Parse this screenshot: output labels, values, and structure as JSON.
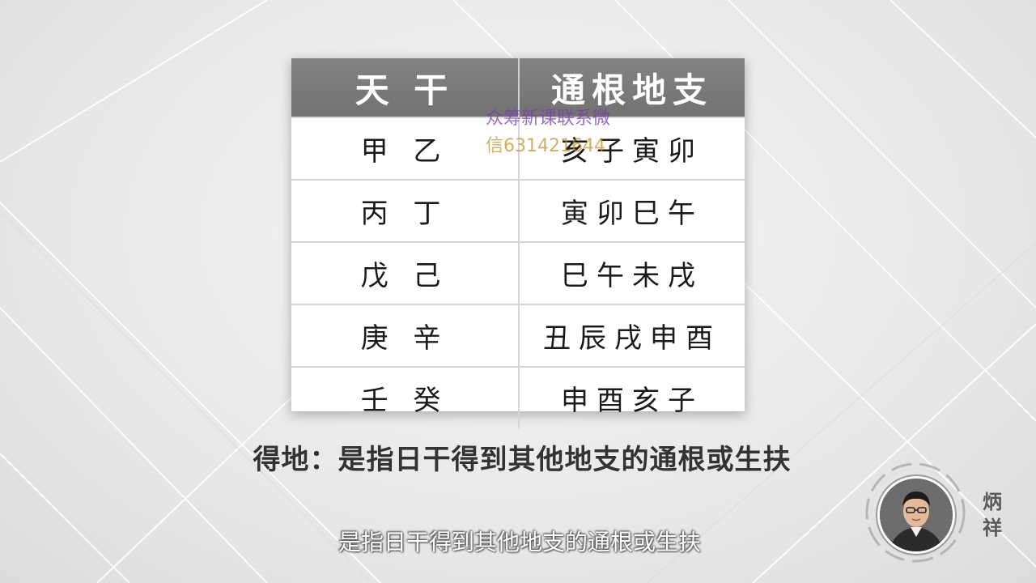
{
  "table": {
    "headers": [
      "天 干",
      "通根地支"
    ],
    "rows": [
      [
        "甲 乙",
        "亥子寅卯"
      ],
      [
        "丙 丁",
        "寅卯巳午"
      ],
      [
        "戊 己",
        "巳午未戌"
      ],
      [
        "庚 辛",
        "丑辰戌申酉"
      ],
      [
        "壬 癸",
        "申酉亥子"
      ]
    ]
  },
  "watermark": {
    "line1": "众筹新课联系微",
    "line2": "信631421644"
  },
  "caption": "得地：是指日干得到其他地支的通根或生扶",
  "subtitle": "是指日干得到其他地支的通根或生扶",
  "presenter": {
    "name": "炳祥"
  }
}
